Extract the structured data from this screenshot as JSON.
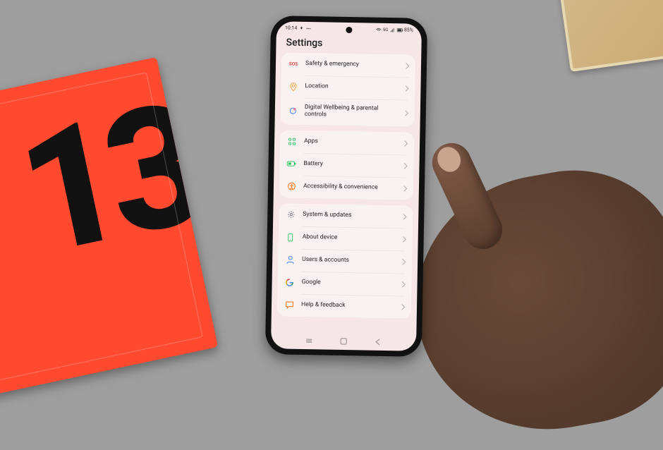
{
  "scene": {
    "box_digits": "13"
  },
  "statusbar": {
    "time": "10:14",
    "battery": "85%"
  },
  "title": "Settings",
  "groups": [
    {
      "rows": [
        {
          "icon": "sos",
          "label": "Safety & emergency"
        },
        {
          "icon": "location",
          "label": "Location"
        },
        {
          "icon": "wellbeing",
          "label": "Digital Wellbeing & parental controls"
        }
      ]
    },
    {
      "rows": [
        {
          "icon": "apps",
          "label": "Apps"
        },
        {
          "icon": "battery",
          "label": "Battery"
        },
        {
          "icon": "access",
          "label": "Accessibility & convenience"
        }
      ]
    },
    {
      "rows": [
        {
          "icon": "system",
          "label": "System & updates"
        },
        {
          "icon": "about",
          "label": "About device"
        },
        {
          "icon": "users",
          "label": "Users & accounts"
        },
        {
          "icon": "google",
          "label": "Google"
        },
        {
          "icon": "help",
          "label": "Help & feedback"
        }
      ]
    }
  ]
}
